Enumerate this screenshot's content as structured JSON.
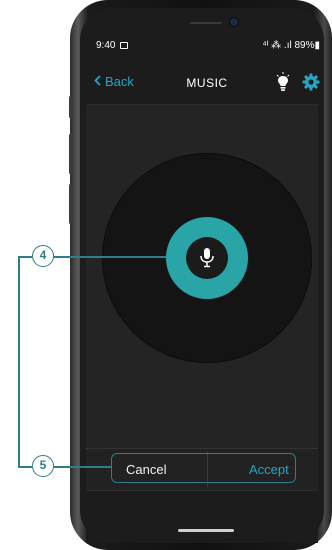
{
  "status_bar": {
    "time": "9:40",
    "indicators": "⁴ᴵ ⁂ .ıl 89%▮"
  },
  "header": {
    "back_label": "Back",
    "title": "MUSIC",
    "bulb_icon": "lightbulb-icon",
    "gear_icon": "gear-icon"
  },
  "main": {
    "mic_icon": "microphone-icon"
  },
  "footer": {
    "cancel_label": "Cancel",
    "accept_label": "Accept"
  },
  "callouts": {
    "mic": "4",
    "actions": "5"
  },
  "colors": {
    "accent": "#29a5c4",
    "ring": "#2aa5a7",
    "callout": "#2f7c8c"
  }
}
